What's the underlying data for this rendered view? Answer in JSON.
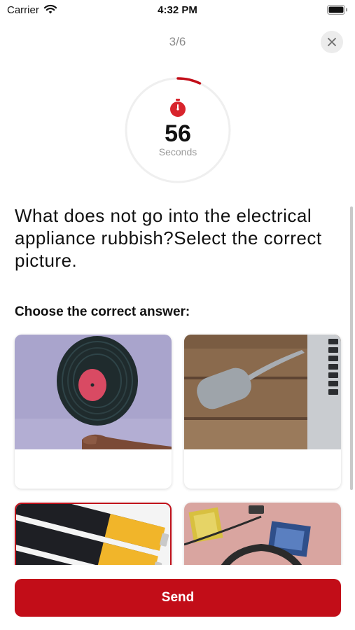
{
  "status_bar": {
    "carrier": "Carrier",
    "time": "4:32 PM"
  },
  "header": {
    "progress": "3/6",
    "progress_current": 3,
    "progress_total": 6
  },
  "timer": {
    "value": "56",
    "label": "Seconds",
    "remaining_fraction": 0.07
  },
  "question": {
    "text": "What does not go into the electrical appliance rubbish?Select the correct picture.",
    "instruction": "Choose the correct answer:"
  },
  "answers": [
    {
      "image": "vinyl-record",
      "selected": false
    },
    {
      "image": "usb-hub-laptop",
      "selected": false
    },
    {
      "image": "batteries",
      "selected": true
    },
    {
      "image": "headphones-minidiscs",
      "selected": false
    }
  ],
  "send_button": {
    "label": "Send"
  },
  "colors": {
    "accent": "#c20d18",
    "muted": "#8a8a8a"
  }
}
